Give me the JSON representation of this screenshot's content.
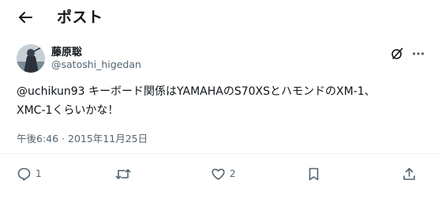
{
  "header": {
    "title": "ポスト"
  },
  "post": {
    "author_name": "藤原聡",
    "handle": "@satoshi_higedan",
    "mention": "@uchikun93",
    "text_rest": " キーボード関係はYAMAHAのS70XSとハモンドのXM-1、\nXMC-1くらいかな！",
    "timestamp": "午後6:46 · 2015年11月25日"
  },
  "actions": {
    "reply_count": "1",
    "like_count": "2"
  },
  "icons": {
    "back": "back-arrow-icon",
    "grok": "grok-icon",
    "more": "more-icon",
    "reply": "reply-icon",
    "retweet": "retweet-icon",
    "like": "heart-icon",
    "bookmark": "bookmark-icon",
    "share": "share-icon"
  }
}
